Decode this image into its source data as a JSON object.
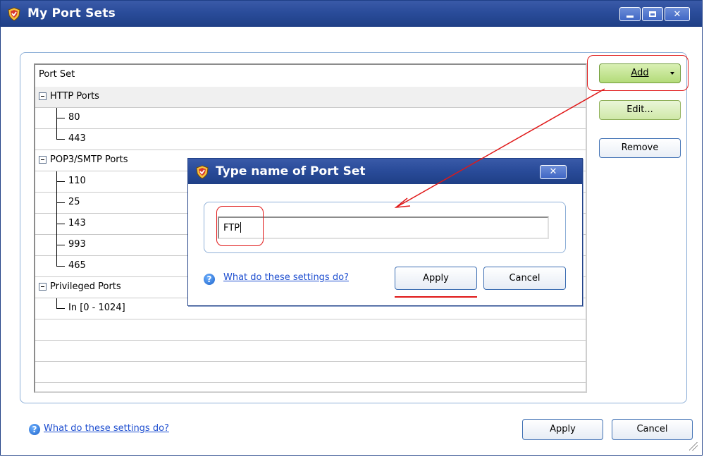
{
  "window": {
    "title": "My Port Sets"
  },
  "list": {
    "header": "Port Set",
    "groups": [
      {
        "name": "HTTP Ports",
        "items": [
          "80",
          "443"
        ]
      },
      {
        "name": "POP3/SMTP Ports",
        "items": [
          "110",
          "25",
          "143",
          "993",
          "465"
        ]
      },
      {
        "name": "Privileged Ports",
        "items": [
          "In [0 - 1024]"
        ]
      }
    ]
  },
  "side_buttons": {
    "add": "Add",
    "edit": "Edit...",
    "remove": "Remove"
  },
  "footer": {
    "help_link": "What do these settings do?",
    "apply": "Apply",
    "cancel": "Cancel"
  },
  "dialog": {
    "title": "Type name of Port Set",
    "input_value": "FTP",
    "help_link": "What do these settings do?",
    "apply": "Apply",
    "cancel": "Cancel",
    "close_glyph": "✕"
  },
  "colors": {
    "titlebar": "#1f3f86",
    "annotation": "#e01818",
    "link": "#1f4fd0",
    "add_button": "#b3db79"
  }
}
